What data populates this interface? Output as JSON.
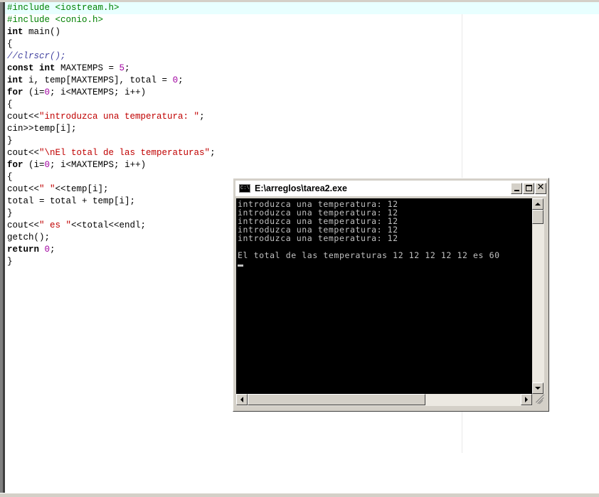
{
  "editor": {
    "lines": [
      {
        "tokens": [
          {
            "t": "#include <iostream.h>",
            "c": "pre"
          }
        ],
        "current": true
      },
      {
        "tokens": [
          {
            "t": "#include <conio.h>",
            "c": "pre"
          }
        ]
      },
      {
        "tokens": [
          {
            "t": "int",
            "c": "kw"
          },
          {
            "t": " main()",
            "c": "plain"
          }
        ]
      },
      {
        "tokens": [
          {
            "t": "{",
            "c": "plain"
          }
        ]
      },
      {
        "tokens": [
          {
            "t": "//clrscr();",
            "c": "cmt"
          }
        ]
      },
      {
        "tokens": [
          {
            "t": "const int",
            "c": "kw"
          },
          {
            "t": " MAXTEMPS = ",
            "c": "plain"
          },
          {
            "t": "5",
            "c": "num"
          },
          {
            "t": ";",
            "c": "plain"
          }
        ]
      },
      {
        "tokens": [
          {
            "t": "int",
            "c": "kw"
          },
          {
            "t": " i, temp[MAXTEMPS], total = ",
            "c": "plain"
          },
          {
            "t": "0",
            "c": "num"
          },
          {
            "t": ";",
            "c": "plain"
          }
        ]
      },
      {
        "tokens": [
          {
            "t": "for",
            "c": "kw"
          },
          {
            "t": " (i=",
            "c": "plain"
          },
          {
            "t": "0",
            "c": "num"
          },
          {
            "t": "; i<MAXTEMPS; i++)",
            "c": "plain"
          }
        ]
      },
      {
        "tokens": [
          {
            "t": "{",
            "c": "plain"
          }
        ]
      },
      {
        "tokens": [
          {
            "t": "cout<<",
            "c": "plain"
          },
          {
            "t": "\"introduzca una temperatura: \"",
            "c": "str"
          },
          {
            "t": ";",
            "c": "plain"
          }
        ]
      },
      {
        "tokens": [
          {
            "t": "cin>>temp[i];",
            "c": "plain"
          }
        ]
      },
      {
        "tokens": [
          {
            "t": "}",
            "c": "plain"
          }
        ]
      },
      {
        "tokens": [
          {
            "t": "cout<<",
            "c": "plain"
          },
          {
            "t": "\"\\nEl total de las temperaturas\"",
            "c": "str"
          },
          {
            "t": ";",
            "c": "plain"
          }
        ]
      },
      {
        "tokens": [
          {
            "t": "for",
            "c": "kw"
          },
          {
            "t": " (i=",
            "c": "plain"
          },
          {
            "t": "0",
            "c": "num"
          },
          {
            "t": "; i<MAXTEMPS; i++)",
            "c": "plain"
          }
        ]
      },
      {
        "tokens": [
          {
            "t": "{",
            "c": "plain"
          }
        ]
      },
      {
        "tokens": [
          {
            "t": "cout<<",
            "c": "plain"
          },
          {
            "t": "\" \"",
            "c": "str"
          },
          {
            "t": "<<temp[i];",
            "c": "plain"
          }
        ]
      },
      {
        "tokens": [
          {
            "t": "total = total + temp[i];",
            "c": "plain"
          }
        ]
      },
      {
        "tokens": [
          {
            "t": "}",
            "c": "plain"
          }
        ]
      },
      {
        "tokens": [
          {
            "t": "cout<<",
            "c": "plain"
          },
          {
            "t": "\" es \"",
            "c": "str"
          },
          {
            "t": "<<total<<endl;",
            "c": "plain"
          }
        ]
      },
      {
        "tokens": [
          {
            "t": "getch();",
            "c": "plain"
          }
        ]
      },
      {
        "tokens": [
          {
            "t": "return",
            "c": "kw"
          },
          {
            "t": " ",
            "c": "plain"
          },
          {
            "t": "0",
            "c": "num"
          },
          {
            "t": ";",
            "c": "plain"
          }
        ]
      },
      {
        "tokens": [
          {
            "t": "}",
            "c": "plain"
          }
        ]
      }
    ]
  },
  "console": {
    "title": "E:\\arreglos\\tarea2.exe",
    "icon": "console-icon",
    "output": [
      "introduzca una temperatura: 12",
      "introduzca una temperatura: 12",
      "introduzca una temperatura: 12",
      "introduzca una temperatura: 12",
      "introduzca una temperatura: 12",
      "",
      "El total de las temperaturas 12 12 12 12 12 es 60"
    ]
  },
  "colors": {
    "keyword": "#000000",
    "preprocessor": "#008000",
    "string": "#c00000",
    "number": "#a000a0",
    "comment": "#00007f",
    "current_line": "#e8ffff",
    "console_bg": "#000000",
    "console_fg": "#c0c0c0"
  }
}
